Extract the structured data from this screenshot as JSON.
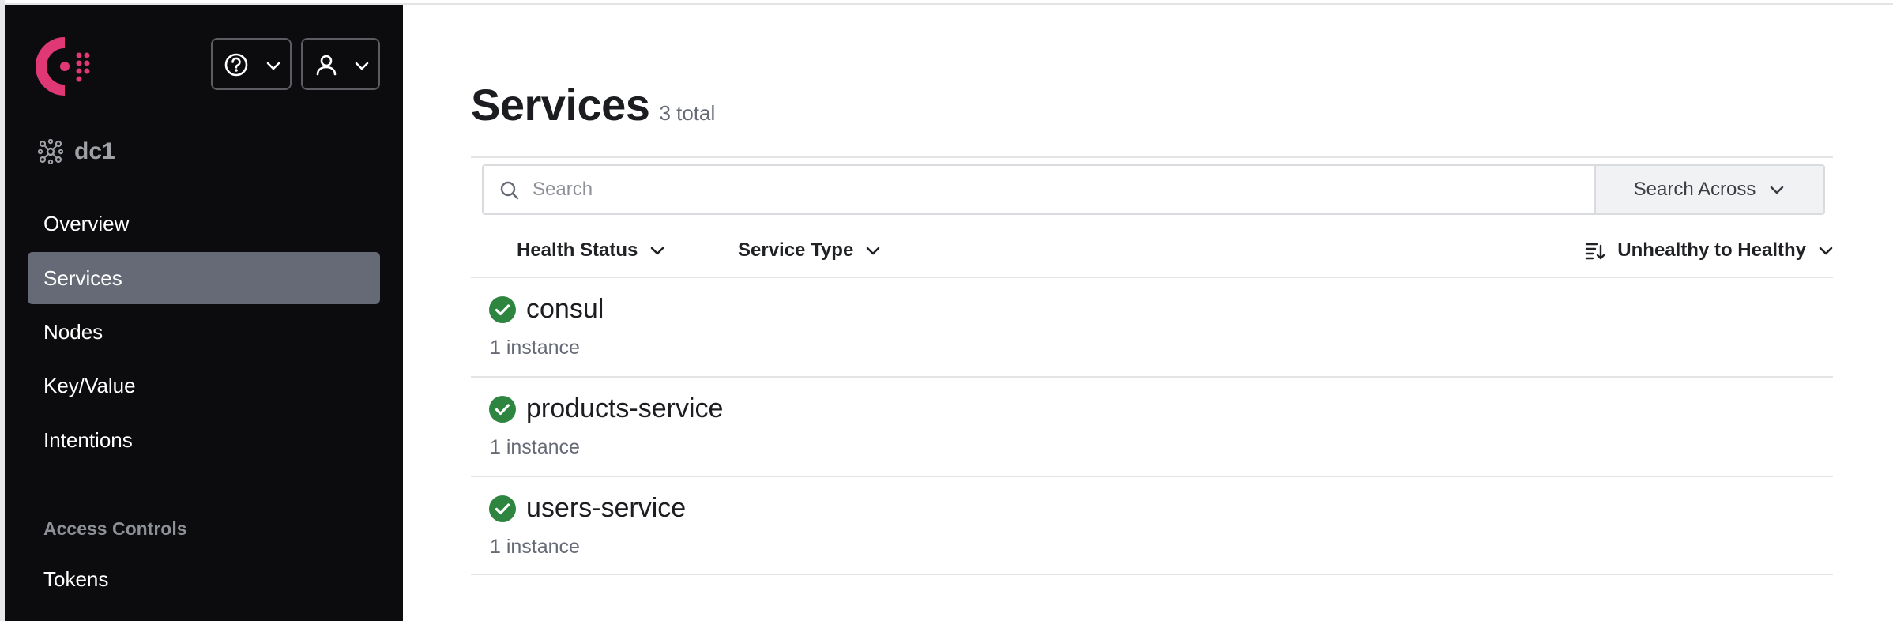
{
  "brand": {
    "accent": "#e03875",
    "sidebar_bg": "#0c0c0e",
    "active_bg": "#656a76",
    "success": "#2e8540"
  },
  "header": {
    "help_icon": "question-circle-icon",
    "user_icon": "user-icon"
  },
  "datacenter": {
    "icon": "cluster-icon",
    "label": "dc1"
  },
  "nav": {
    "items": [
      {
        "label": "Overview"
      },
      {
        "label": "Services"
      },
      {
        "label": "Nodes"
      },
      {
        "label": "Key/Value"
      },
      {
        "label": "Intentions"
      }
    ],
    "section_access": "Access Controls",
    "access_items": [
      {
        "label": "Tokens"
      }
    ]
  },
  "page": {
    "title": "Services",
    "total": "3 total"
  },
  "search": {
    "placeholder": "Search",
    "value": "",
    "across_label": "Search Across"
  },
  "filters": {
    "health": "Health Status",
    "type": "Service Type",
    "sort": "Unhealthy to Healthy"
  },
  "services": [
    {
      "name": "consul",
      "instances": "1 instance",
      "status": "passing"
    },
    {
      "name": "products-service",
      "instances": "1 instance",
      "status": "passing"
    },
    {
      "name": "users-service",
      "instances": "1 instance",
      "status": "passing"
    }
  ]
}
